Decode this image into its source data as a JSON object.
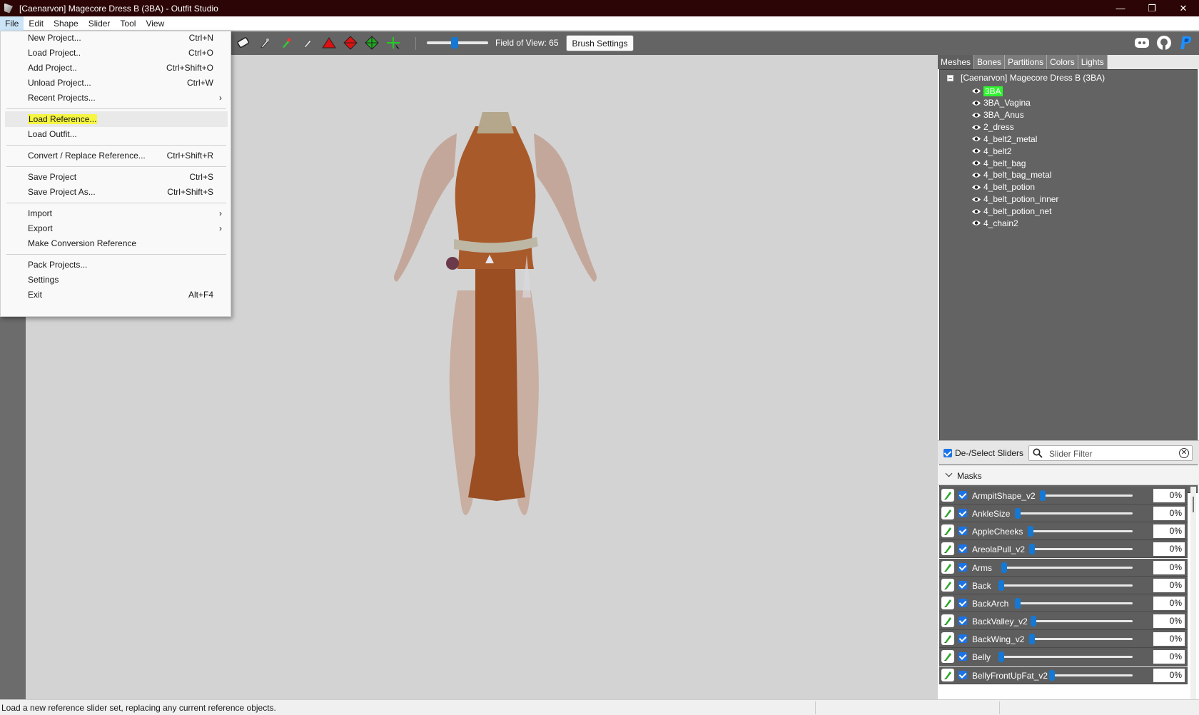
{
  "window": {
    "title": "[Caenarvon] Magecore Dress B (3BA) - Outfit Studio",
    "controls": [
      "—",
      "❐",
      "✕"
    ]
  },
  "menubar": [
    "File",
    "Edit",
    "Shape",
    "Slider",
    "Tool",
    "View"
  ],
  "file_menu": {
    "items": [
      {
        "label": "New Project...",
        "shortcut": "Ctrl+N"
      },
      {
        "label": "Load Project..",
        "shortcut": "Ctrl+O"
      },
      {
        "label": "Add Project..",
        "shortcut": "Ctrl+Shift+O"
      },
      {
        "label": "Unload Project...",
        "shortcut": "Ctrl+W"
      },
      {
        "label": "Recent Projects...",
        "shortcut": "",
        "submenu": true
      },
      {
        "label": "Load Reference...",
        "shortcut": "",
        "highlighted": true
      },
      {
        "label": "Load Outfit...",
        "shortcut": ""
      },
      {
        "label": "Convert / Replace Reference...",
        "shortcut": "Ctrl+Shift+R"
      },
      {
        "label": "Save Project",
        "shortcut": "Ctrl+S"
      },
      {
        "label": "Save Project As...",
        "shortcut": "Ctrl+Shift+S"
      },
      {
        "label": "Import",
        "shortcut": "",
        "submenu": true
      },
      {
        "label": "Export",
        "shortcut": "",
        "submenu": true
      },
      {
        "label": "Make Conversion Reference",
        "shortcut": ""
      },
      {
        "label": "Pack Projects...",
        "shortcut": ""
      },
      {
        "label": "Settings",
        "shortcut": ""
      },
      {
        "label": "Exit",
        "shortcut": "Alt+F4"
      }
    ]
  },
  "toolbar": {
    "fov_label": "Field of View: 65",
    "fov_value": 65,
    "brush_settings_label": "Brush Settings",
    "icons": [
      "eraser-icon",
      "brush-icon",
      "color-brush-icon",
      "smooth-brush-icon",
      "red-triangle-icon",
      "red-diamond-icon",
      "green-diamond-icon",
      "transform-icon"
    ],
    "social_icons": [
      "discord-icon",
      "github-icon",
      "paypal-icon"
    ]
  },
  "panel": {
    "tabs": [
      "Meshes",
      "Bones",
      "Partitions",
      "Colors",
      "Lights"
    ],
    "active_tab": "Meshes",
    "tree_root": "[Caenarvon] Magecore Dress B (3BA)",
    "meshes": [
      "3BA",
      "3BA_Vagina",
      "3BA_Anus",
      "2_dress",
      "4_belt2_metal",
      "4_belt2",
      "4_belt_bag",
      "4_belt_bag_metal",
      "4_belt_potion",
      "4_belt_potion_inner",
      "4_belt_potion_net",
      "4_chain2"
    ],
    "selected_mesh": "3BA",
    "highlight_color": "#2ef52e"
  },
  "sliders_panel": {
    "deselect_label": "De-/Select Sliders",
    "filter_placeholder": "Slider Filter",
    "masks_label": "Masks",
    "sliders": [
      {
        "name": "ArmpitShape_v2",
        "value": "0%"
      },
      {
        "name": "AnkleSize",
        "value": "0%"
      },
      {
        "name": "AppleCheeks",
        "value": "0%"
      },
      {
        "name": "AreolaPull_v2",
        "value": "0%"
      },
      {
        "name": "Arms",
        "value": "0%"
      },
      {
        "name": "Back",
        "value": "0%"
      },
      {
        "name": "BackArch",
        "value": "0%"
      },
      {
        "name": "BackValley_v2",
        "value": "0%"
      },
      {
        "name": "BackWing_v2",
        "value": "0%"
      },
      {
        "name": "Belly",
        "value": "0%"
      },
      {
        "name": "BellyFrontUpFat_v2",
        "value": "0%"
      }
    ]
  },
  "statusbar": {
    "message": "Load a new reference slider set, replacing any current reference objects."
  },
  "colors": {
    "titlebar": "#2c0506",
    "accent": "#1478d4",
    "highlight": "#f5f542"
  }
}
